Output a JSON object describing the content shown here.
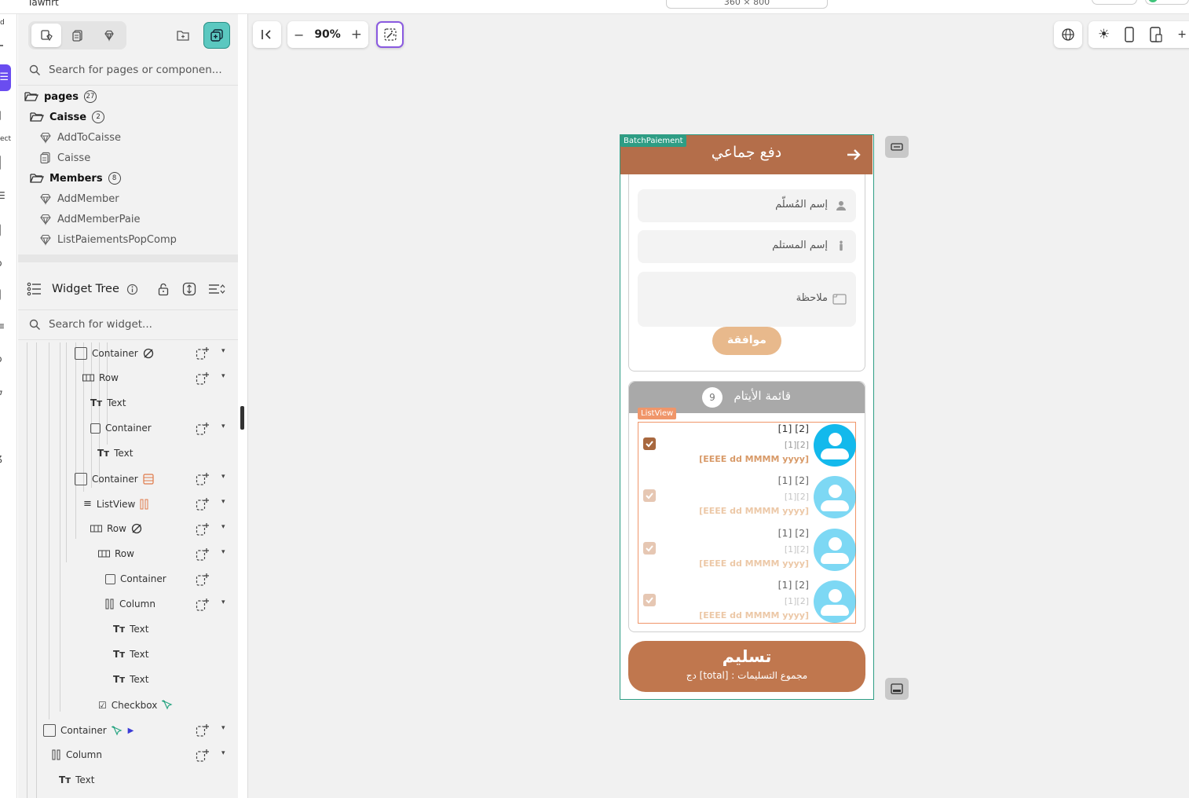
{
  "app": {
    "title": "Tawfirt",
    "device_label": "360 × 800",
    "zoom": "90%"
  },
  "rail": {
    "texts": [
      "d",
      "ect"
    ]
  },
  "left_panel": {
    "search_pages_placeholder": "Search for pages or componen...",
    "tree": {
      "root": {
        "label": "pages",
        "count": "27"
      },
      "folders": [
        {
          "label": "Caisse",
          "count": "2",
          "items": [
            {
              "label": "AddToCaisse",
              "icon": "component-icon"
            },
            {
              "label": "Caisse",
              "icon": "page-icon"
            }
          ]
        },
        {
          "label": "Members",
          "count": "8",
          "items": [
            {
              "label": "AddMember",
              "icon": "component-icon"
            },
            {
              "label": "AddMemberPaie",
              "icon": "component-icon"
            },
            {
              "label": "ListPaiementsPopComp",
              "icon": "component-icon"
            }
          ]
        }
      ]
    },
    "widget_tree_title": "Widget Tree",
    "search_widget_placeholder": "Search for widget...",
    "widgets": [
      {
        "label": "Container",
        "type": "container",
        "has_caret": true
      },
      {
        "label": "Row",
        "type": "row",
        "has_caret": true
      },
      {
        "label": "Text",
        "type": "text",
        "has_caret": false
      },
      {
        "label": "Container",
        "type": "container",
        "has_caret": true
      },
      {
        "label": "Text",
        "type": "text",
        "has_caret": false
      },
      {
        "label": "Container",
        "type": "container",
        "has_caret": true
      },
      {
        "label": "ListView",
        "type": "listview",
        "has_caret": true
      },
      {
        "label": "Row",
        "type": "row",
        "has_caret": true
      },
      {
        "label": "Row",
        "type": "row",
        "has_caret": true
      },
      {
        "label": "Container",
        "type": "container",
        "has_caret": false
      },
      {
        "label": "Column",
        "type": "column",
        "has_caret": true
      },
      {
        "label": "Text",
        "type": "text",
        "has_caret": false
      },
      {
        "label": "Text",
        "type": "text",
        "has_caret": false
      },
      {
        "label": "Text",
        "type": "text",
        "has_caret": false
      },
      {
        "label": "Checkbox",
        "type": "checkbox",
        "has_caret": false
      },
      {
        "label": "Container",
        "type": "container",
        "has_caret": true
      },
      {
        "label": "Column",
        "type": "column",
        "has_caret": true
      },
      {
        "label": "Text",
        "type": "text",
        "has_caret": false
      }
    ]
  },
  "phone": {
    "page_tag": "BatchPaiement",
    "appbar_title": "دفع جماعي",
    "fields": {
      "payer_name": "إسم المُسلّم",
      "receiver_name": "إسم المستلم",
      "note": "ملاحظة"
    },
    "ok_button": "موافقة",
    "orphans_list_title": "قائمة الأيتام",
    "orphans_count": "9",
    "listview_tag": "ListView",
    "items": [
      {
        "line1": "[1] [2]",
        "line2": "[1][2]",
        "line3": "[EEEE dd MMMM yyyy]"
      },
      {
        "line1": "[1] [2]",
        "line2": "[1][2]",
        "line3": "[EEEE dd MMMM yyyy]"
      },
      {
        "line1": "[1] [2]",
        "line2": "[1][2]",
        "line3": "[EEEE dd MMMM yyyy]"
      },
      {
        "line1": "[1] [2]",
        "line2": "[1][2]",
        "line3": "[EEEE dd MMMM yyyy]"
      }
    ],
    "submit_title": "تسليم",
    "submit_subtitle": "مجموع التسليمات : [total] دج"
  },
  "colors": {
    "accent": "#5bc8c0",
    "brand_brown": "#b46e4a",
    "rail_active": "#6a4df0",
    "avatar": "#13b9ec",
    "listview_outline": "#f0966a",
    "page_tag": "#2e9d84"
  }
}
